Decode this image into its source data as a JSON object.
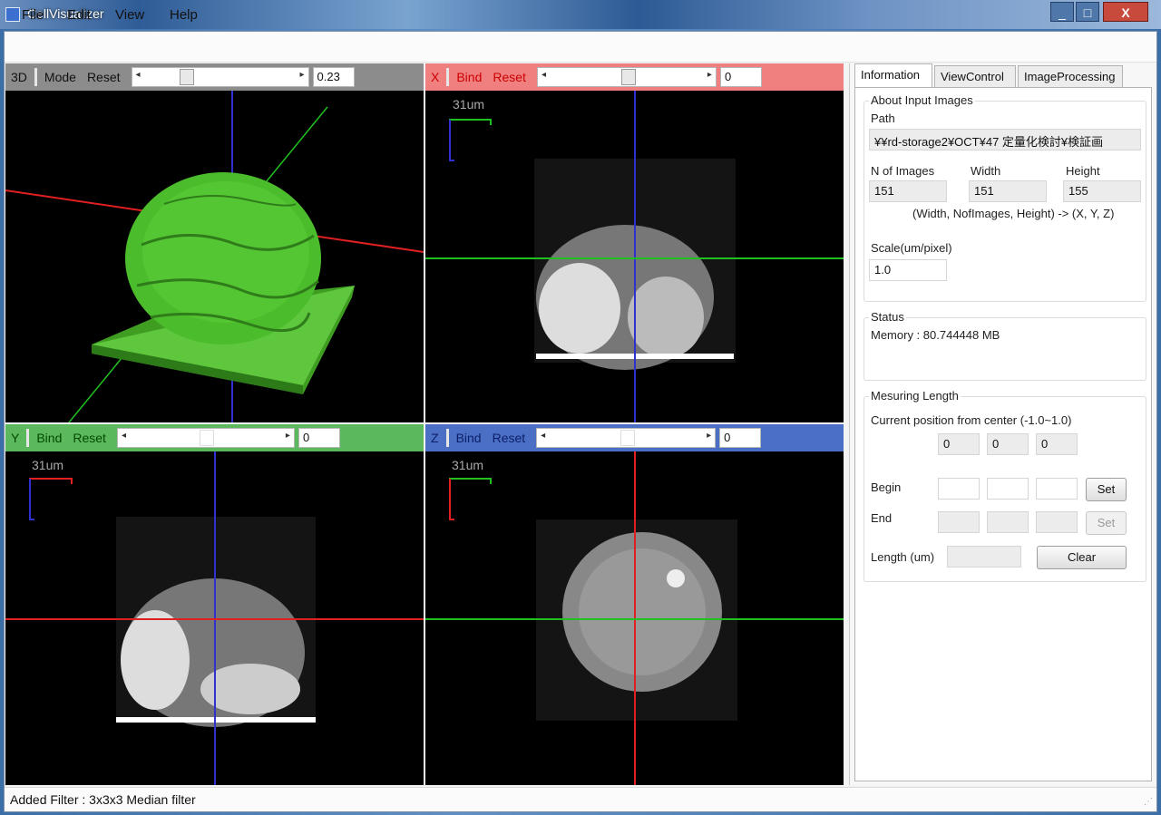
{
  "window": {
    "title": "CellVisualizer",
    "minimize": "_",
    "maximize": "□",
    "close": "X"
  },
  "menu": [
    "File",
    "Edit",
    "View",
    "Help"
  ],
  "viewports": {
    "v3d": {
      "label": "3D",
      "mode": "Mode",
      "reset": "Reset",
      "value": "0.23",
      "slider_fraction": 0.3,
      "header_color": "#8c8c8c"
    },
    "x": {
      "label": "X",
      "bind": "Bind",
      "reset": "Reset",
      "value": "0",
      "slider_fraction": 0.5,
      "header_color": "#f08080",
      "scale": "31um"
    },
    "y": {
      "label": "Y",
      "bind": "Bind",
      "reset": "Reset",
      "value": "0",
      "slider_fraction": 0.5,
      "header_color": "#5cb85c",
      "scale": "31um"
    },
    "z": {
      "label": "Z",
      "bind": "Bind",
      "reset": "Reset",
      "value": "0",
      "slider_fraction": 0.5,
      "header_color": "#4a6fc4",
      "scale": "31um"
    }
  },
  "tabs": [
    "Information",
    "ViewControl",
    "ImageProcessing"
  ],
  "info": {
    "about_title": "About Input Images",
    "path_label": "Path",
    "path_value": "¥¥rd-storage2¥OCT¥47 定量化検討¥検証画",
    "n_images_label": "N of Images",
    "width_label": "Width",
    "height_label": "Height",
    "n_images": "151",
    "width": "151",
    "height": "155",
    "mapping_note": "(Width, NofImages, Height) -> (X, Y, Z)",
    "scale_label": "Scale(um/pixel)",
    "scale_value": "1.0",
    "status_title": "Status",
    "memory": "Memory : 80.744448 MB",
    "measure_title": "Mesuring Length",
    "current_pos_label": "Current position from center (-1.0~1.0)",
    "current_pos": [
      "0",
      "0",
      "0"
    ],
    "begin_label": "Begin",
    "end_label": "End",
    "set_label": "Set",
    "length_label": "Length (um)",
    "clear_label": "Clear"
  },
  "status_bar": "Added Filter : 3x3x3 Median filter",
  "colors": {
    "green_mesh": "#4bbd2c",
    "axis_red": "#e02020",
    "axis_green": "#20c020",
    "axis_blue": "#3030d0"
  }
}
